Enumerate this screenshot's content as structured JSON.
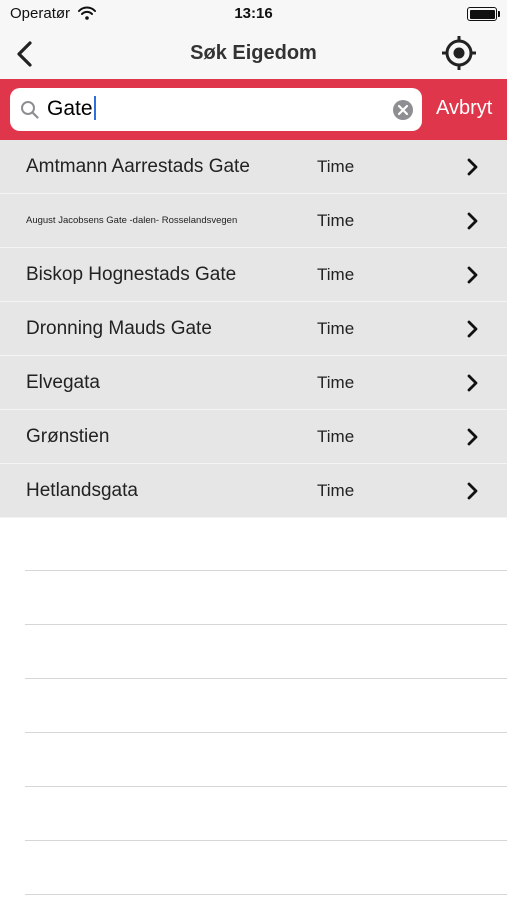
{
  "status_bar": {
    "carrier": "Operatør",
    "time": "13:16",
    "icons": [
      "wifi-icon",
      "battery-icon"
    ]
  },
  "nav": {
    "title": "Søk Eigedom",
    "back_icon": "chevron-left-icon",
    "locate_icon": "location-crosshair-icon"
  },
  "search": {
    "value": "Gate",
    "cancel_label": "Avbryt",
    "icons": [
      "search-icon",
      "clear-icon"
    ]
  },
  "results": [
    {
      "street": "Amtmann Aarrestads Gate",
      "area": "Time"
    },
    {
      "street": "August Jacobsens Gate -dalen- Rosselandsvegen",
      "area": "Time"
    },
    {
      "street": "Biskop Hognestads Gate",
      "area": "Time"
    },
    {
      "street": "Dronning Mauds Gate",
      "area": "Time"
    },
    {
      "street": "Elvegata",
      "area": "Time"
    },
    {
      "street": "Grønstien",
      "area": "Time"
    },
    {
      "street": "Hetlandsgata",
      "area": "Time"
    }
  ],
  "colors": {
    "accent": "#e0364b",
    "row_background": "#e6e6e6",
    "bar_background": "#f7f7f7"
  }
}
